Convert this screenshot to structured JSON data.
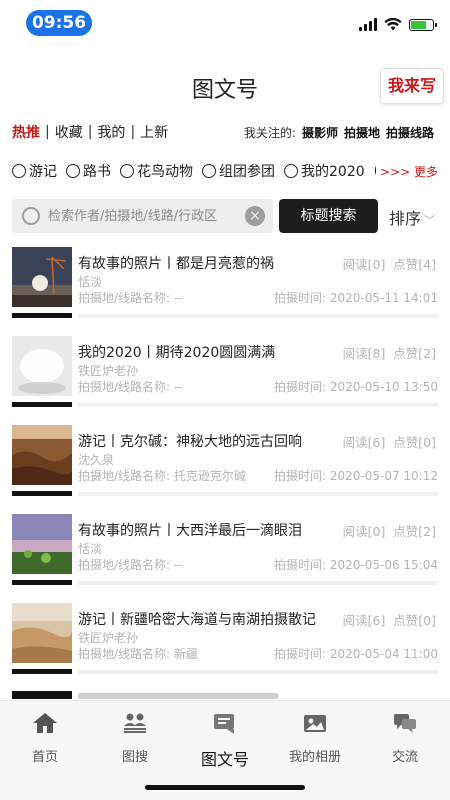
{
  "status": {
    "time": "09:56"
  },
  "header": {
    "title": "图文号",
    "write_label": "我来写"
  },
  "nav": {
    "items": [
      {
        "label": "热推",
        "active": true
      },
      {
        "label": "收藏"
      },
      {
        "label": "我的"
      },
      {
        "label": "上新"
      }
    ],
    "sep": "|"
  },
  "follow": {
    "label": "我关注的:",
    "items": [
      "摄影师",
      "拍摄地",
      "拍摄线路"
    ]
  },
  "categories": [
    "游记",
    "路书",
    "花鸟动物",
    "组团参团",
    "我的2020",
    "("
  ],
  "more_label": ">>> 更多",
  "search": {
    "placeholder": "检索作者/拍摄地/线路/行政区",
    "button": "标题搜索",
    "sort": "排序"
  },
  "posts": [
    {
      "title": "有故事的照片丨都是月亮惹的祸",
      "author": "恬淡",
      "location": "拍摄地/线路名称: --",
      "time": "拍摄时间: 2020-05-11 14:01",
      "reads": "阅读[0]",
      "likes": "点赞[4]"
    },
    {
      "title": "我的2020丨期待2020圆圆满满",
      "author": "铁匠炉老孙",
      "location": "拍摄地/线路名称: --",
      "time": "拍摄时间: 2020-05-10 13:50",
      "reads": "阅读[8]",
      "likes": "点赞[2]"
    },
    {
      "title": "游记丨克尔碱：神秘大地的远古回响",
      "author": "沈久泉",
      "location": "拍摄地/线路名称: 托克逊克尔碱",
      "time": "拍摄时间: 2020-05-07 10:12",
      "reads": "阅读[6]",
      "likes": "点赞[0]"
    },
    {
      "title": "有故事的照片丨大西洋最后一滴眼泪",
      "author": "恬淡",
      "location": "拍摄地/线路名称: --",
      "time": "拍摄时间: 2020-05-06 15:04",
      "reads": "阅读[0]",
      "likes": "点赞[2]"
    },
    {
      "title": "游记丨新疆哈密大海道与南湖拍摄散记",
      "author": "铁匠炉老孙",
      "location": "拍摄地/线路名称: 新疆",
      "time": "拍摄时间: 2020-05-04 11:00",
      "reads": "阅读[6]",
      "likes": "点赞[0]"
    }
  ],
  "tabs": [
    {
      "label": "首页",
      "icon": "home-icon"
    },
    {
      "label": "图搜",
      "icon": "people-search-icon"
    },
    {
      "label": "图文号",
      "icon": "article-icon",
      "active": true
    },
    {
      "label": "我的相册",
      "icon": "album-icon"
    },
    {
      "label": "交流",
      "icon": "chat-icon"
    }
  ],
  "colors": {
    "accent": "#c91919",
    "time_pill": "#1a73e8",
    "search_button": "#1d1d1d",
    "muted_text": "#b5b5b5",
    "battery": "#3cc13b"
  }
}
